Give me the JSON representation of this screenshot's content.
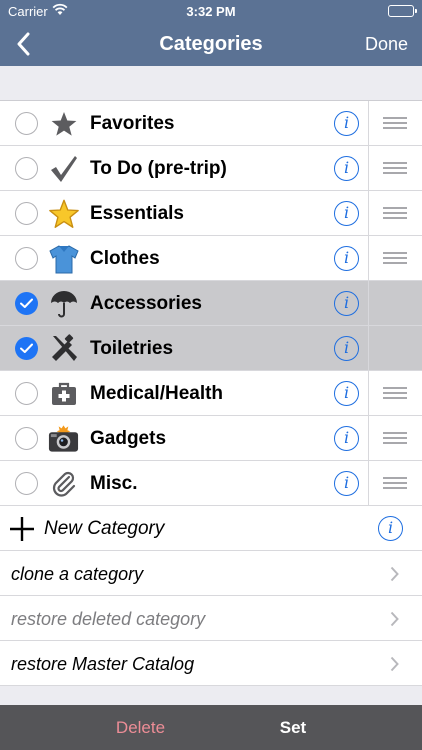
{
  "status": {
    "carrier": "Carrier",
    "time": "3:32 PM"
  },
  "nav": {
    "title": "Categories",
    "done_label": "Done"
  },
  "categories": [
    {
      "label": "Favorites",
      "icon": "star-icon",
      "selected": false,
      "reorderable": true
    },
    {
      "label": "To Do (pre-trip)",
      "icon": "checkmark-icon",
      "selected": false,
      "reorderable": true
    },
    {
      "label": "Essentials",
      "icon": "gold-star-icon",
      "selected": false,
      "reorderable": true
    },
    {
      "label": "Clothes",
      "icon": "shirt-icon",
      "selected": false,
      "reorderable": true
    },
    {
      "label": "Accessories",
      "icon": "umbrella-icon",
      "selected": true,
      "reorderable": false
    },
    {
      "label": "Toiletries",
      "icon": "toiletries-icon",
      "selected": true,
      "reorderable": false
    },
    {
      "label": "Medical/Health",
      "icon": "medical-kit-icon",
      "selected": false,
      "reorderable": true
    },
    {
      "label": "Gadgets",
      "icon": "camera-icon",
      "selected": false,
      "reorderable": true
    },
    {
      "label": "Misc.",
      "icon": "paperclip-icon",
      "selected": false,
      "reorderable": true
    }
  ],
  "new_category": {
    "label": "New Category"
  },
  "actions": [
    {
      "label": "clone a category",
      "enabled": true
    },
    {
      "label": "restore deleted category",
      "enabled": false
    },
    {
      "label": "restore Master Catalog",
      "enabled": true
    }
  ],
  "toolbar": {
    "delete_label": "Delete",
    "set_label": "Set"
  },
  "colors": {
    "nav_bar": "#5b7294",
    "selected_row": "#c9c9cc",
    "accent": "#1e74f5",
    "info": "#1e6ee0",
    "delete": "#ec8d96",
    "toolbar": "#555558"
  }
}
